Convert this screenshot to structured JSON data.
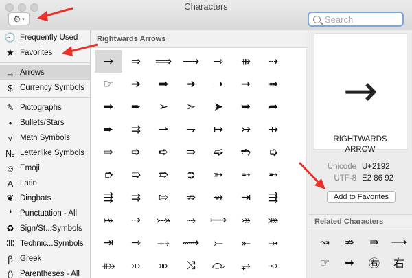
{
  "window": {
    "title": "Characters"
  },
  "toolbar": {
    "gear_icon": "⚙",
    "caret": "▾"
  },
  "search": {
    "placeholder": "Search"
  },
  "sidebar": {
    "items": [
      {
        "icon": "🕘",
        "label": "Frequently Used"
      },
      {
        "icon": "★",
        "label": "Favorites"
      },
      {
        "icon": "→",
        "label": "Arrows",
        "selected": true
      },
      {
        "icon": "$",
        "label": "Currency Symbols"
      },
      {
        "icon": "✎",
        "label": "Pictographs"
      },
      {
        "icon": "•",
        "label": "Bullets/Stars"
      },
      {
        "icon": "√",
        "label": "Math Symbols"
      },
      {
        "icon": "№",
        "label": "Letterlike Symbols"
      },
      {
        "icon": "☺",
        "label": "Emoji"
      },
      {
        "icon": "A",
        "label": "Latin"
      },
      {
        "icon": "❦",
        "label": "Dingbats"
      },
      {
        "icon": "❛",
        "label": "Punctuation - All"
      },
      {
        "icon": "♻",
        "label": "Sign/St...Symbols"
      },
      {
        "icon": "⌘",
        "label": "Technic...Symbols"
      },
      {
        "icon": "β",
        "label": "Greek"
      },
      {
        "icon": "()",
        "label": "Parentheses - All"
      }
    ]
  },
  "grid": {
    "section_title": "Rightwards Arrows",
    "chars": [
      "→",
      "⇒",
      "⟹",
      "⟶",
      "⇾",
      "⇻",
      "⇢",
      "☛",
      "☞",
      "➔",
      "➡",
      "➜",
      "➝",
      "➞",
      "➟",
      "➠",
      "➡",
      "➨",
      "➢",
      "➣",
      "➤",
      "➥",
      "➦",
      "➧",
      "➨",
      "⇉",
      "⇀",
      "⇁",
      "↦",
      "↣",
      "⇸",
      "➪",
      "⇨",
      "➩",
      "➪",
      "⇛",
      "➫",
      "➬",
      "➭",
      "⊃",
      "➮",
      "➯",
      "➱",
      "➲",
      "➳",
      "➵",
      "➸",
      "➹",
      "⇶",
      "⇉",
      "⇰",
      "⇏",
      "⇴",
      "⇥",
      "⇶",
      "➺",
      "⤅",
      "⇢",
      "⤐",
      "⤑",
      "⟼",
      "⤖",
      "⤗",
      "⤘",
      "⇥",
      "⇾",
      "⤏",
      "⟿",
      "⤚",
      "⤜",
      "⤞",
      "⤠",
      "⤁",
      "⤔",
      "⤕",
      "⤨",
      "⤼",
      "⥅",
      "⥇",
      "⥴"
    ],
    "selected_index": 0
  },
  "detail": {
    "preview_char": "→",
    "name_line1": "RIGHTWARDS",
    "name_line2": "ARROW",
    "unicode_label": "Unicode",
    "unicode_value": "U+2192",
    "utf8_label": "UTF-8",
    "utf8_value": "E2 86 92",
    "add_favorites_label": "Add to Favorites",
    "related_title": "Related Characters",
    "related_chars": [
      "↝",
      "⇏",
      "⇛",
      "⟶",
      "☞",
      "➡",
      "㊨",
      "右"
    ]
  },
  "colors": {
    "annotation_arrow": "#e8322a"
  }
}
